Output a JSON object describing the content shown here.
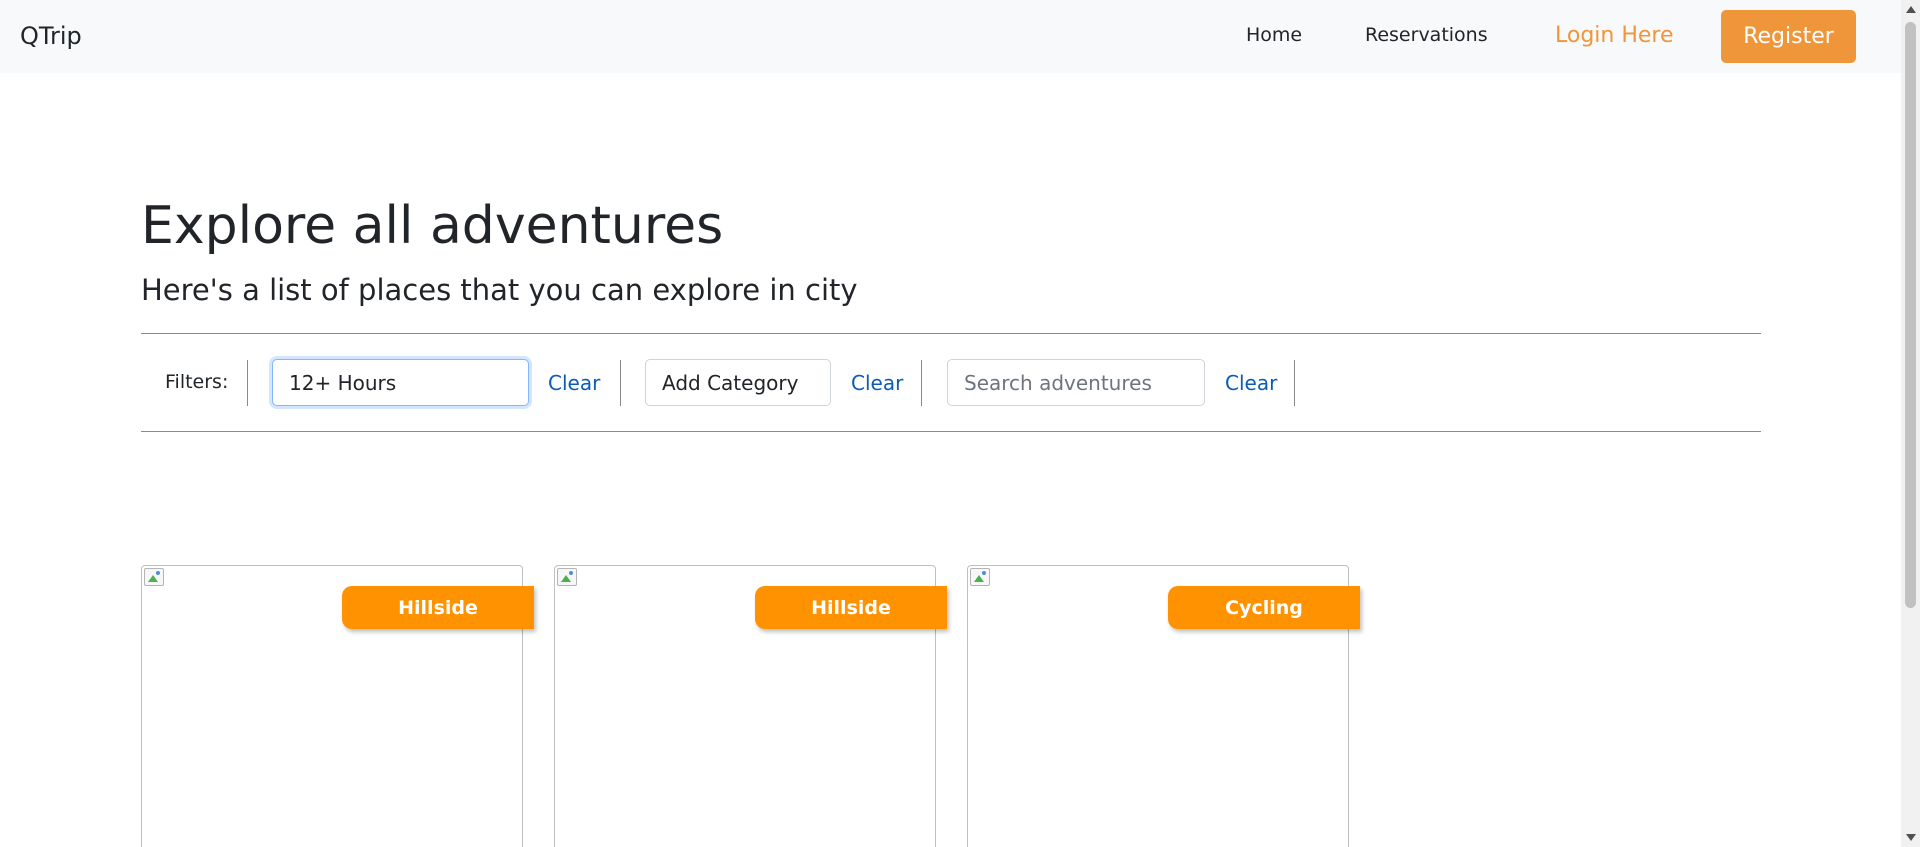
{
  "navbar": {
    "brand": "QTrip",
    "home": "Home",
    "reservations": "Reservations",
    "login": "Login Here",
    "register": "Register"
  },
  "hero": {
    "title": "Explore all adventures",
    "subtitle": "Here's a list of places that you can explore in city"
  },
  "filters": {
    "label": "Filters:",
    "duration_value": "12+ Hours",
    "category_value": "Add Category",
    "search_placeholder": "Search adventures",
    "clear_duration": "Clear",
    "clear_category": "Clear",
    "clear_search": "Clear"
  },
  "cards": [
    {
      "category": "Hillside"
    },
    {
      "category": "Hillside"
    },
    {
      "category": "Cycling"
    }
  ],
  "colors": {
    "accent": "#f0963a",
    "banner": "#ff9200",
    "link": "#0b5cb8",
    "navbar_bg": "#f8f9fa"
  }
}
